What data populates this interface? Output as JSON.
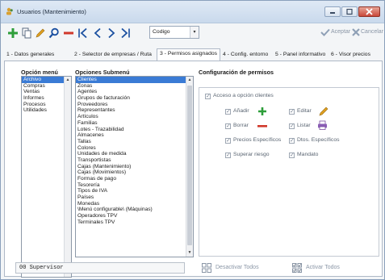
{
  "window": {
    "title": "Usuarios (Mantenimiento)"
  },
  "toolbar": {
    "buttons": [
      {
        "name": "add-icon",
        "color": "#2e9e3a"
      },
      {
        "name": "copy-icon",
        "color": "#5a6a80"
      },
      {
        "name": "edit-icon",
        "color": "#e0a020"
      },
      {
        "name": "search-icon",
        "color": "#1a4fa0"
      },
      {
        "name": "delete-icon",
        "color": "#d0382b"
      },
      {
        "name": "first-icon",
        "color": "#1a4fa0"
      },
      {
        "name": "prev-icon",
        "color": "#1a4fa0"
      },
      {
        "name": "next-icon",
        "color": "#1a4fa0"
      },
      {
        "name": "last-icon",
        "color": "#1a4fa0"
      }
    ],
    "combo_value": "Codigo",
    "accept_label": "Aceptar",
    "cancel_label": "Cancelar"
  },
  "tabs": [
    {
      "label": "1 - Datos generales"
    },
    {
      "label": "2 - Selector de empresas / Ruta"
    },
    {
      "label": "3 - Permisos asignados",
      "active": true
    },
    {
      "label": "4 - Config. entorno"
    },
    {
      "label": "5 - Panel informativo"
    },
    {
      "label": "6 - Visor precios"
    }
  ],
  "menu_options": {
    "header": "Opción menú",
    "items": [
      "Archivo",
      "Compras",
      "Ventas",
      "Informes",
      "Procesos",
      "Utilidades"
    ],
    "selected": 0
  },
  "submenu_options": {
    "header": "Opciones Submenú",
    "items": [
      "Clientes",
      "Zonas",
      "Agentes",
      "Grupos de facturación",
      "Proveedores",
      "Representantes",
      "Artículos",
      "Familias",
      "Lotes - Trazabilidad",
      "Almacenes",
      "Tallas",
      "Colores",
      "Unidades de medida",
      "Transportistas",
      "Cajas (Mantenimiento)",
      "Cajas (Movimientos)",
      "Formas de pago",
      "Tesorería",
      "Tipos de IVA",
      "Países",
      "Monedas",
      "\\Menú configurable\\ (Máquinas)",
      "Operadores TPV",
      "Terminales TPV"
    ],
    "selected": 0
  },
  "permissions": {
    "header": "Configuración de permisos",
    "access_label": "Acceso a opción clientes",
    "items": [
      {
        "label": "Añadir",
        "icon": "add-icon"
      },
      {
        "label": "Editar",
        "icon": "pencil-icon"
      },
      {
        "label": "Borrar",
        "icon": "minus-icon"
      },
      {
        "label": "Listar",
        "icon": "printer-icon"
      },
      {
        "label": "Precios Específicos"
      },
      {
        "label": "Dtos. Específicos"
      },
      {
        "label": "Superar riesgo"
      },
      {
        "label": "Mandato"
      }
    ]
  },
  "status": {
    "user": "00  Supervisor"
  },
  "bottom_buttons": {
    "deactivate_label": "Desactivar Todos",
    "activate_label": "Activar Todos"
  }
}
